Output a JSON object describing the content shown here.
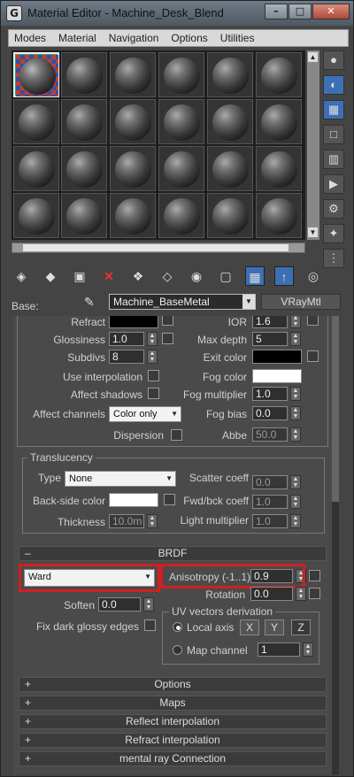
{
  "window": {
    "title": "Material Editor - Machine_Desk_Blend",
    "app_icon": "3ds-max-icon"
  },
  "menubar": [
    "Modes",
    "Material",
    "Navigation",
    "Options",
    "Utilities"
  ],
  "base": {
    "label": "Base:",
    "material_name": "Machine_BaseMetal",
    "material_type": "VRayMtl"
  },
  "refraction": {
    "refract_label": "Refract",
    "ior_label": "IOR",
    "ior_value": "1.6",
    "glossiness_label": "Glossiness",
    "glossiness_value": "1.0",
    "max_depth_label": "Max depth",
    "max_depth_value": "5",
    "subdivs_label": "Subdivs",
    "subdivs_value": "8",
    "exit_color_label": "Exit color",
    "use_interpolation_label": "Use interpolation",
    "fog_color_label": "Fog color",
    "affect_shadows_label": "Affect shadows",
    "fog_multiplier_label": "Fog multiplier",
    "fog_multiplier_value": "1.0",
    "affect_channels_label": "Affect channels",
    "affect_channels_value": "Color only",
    "fog_bias_label": "Fog bias",
    "fog_bias_value": "0.0",
    "dispersion_label": "Dispersion",
    "abbe_label": "Abbe",
    "abbe_value": "50.0"
  },
  "translucency": {
    "title": "Translucency",
    "type_label": "Type",
    "type_value": "None",
    "scatter_coeff_label": "Scatter coeff",
    "scatter_coeff_value": "0.0",
    "backside_color_label": "Back-side color",
    "fwd_bck_coeff_label": "Fwd/bck coeff",
    "fwd_bck_coeff_value": "1.0",
    "thickness_label": "Thickness",
    "thickness_value": "10.0m",
    "light_multiplier_label": "Light multiplier",
    "light_multiplier_value": "1.0"
  },
  "brdf": {
    "title": "BRDF",
    "type_value": "Ward",
    "anisotropy_label": "Anisotropy (-1..1)",
    "anisotropy_value": "0.9",
    "rotation_label": "Rotation",
    "rotation_value": "0.0",
    "soften_label": "Soften",
    "soften_value": "0.0",
    "fix_dark_label": "Fix dark glossy edges",
    "uv_group_title": "UV vectors derivation",
    "local_axis_label": "Local axis",
    "axis_x": "X",
    "axis_y": "Y",
    "axis_z": "Z",
    "map_channel_label": "Map channel",
    "map_channel_value": "1"
  },
  "rollouts": [
    "Options",
    "Maps",
    "Reflect interpolation",
    "Refract interpolation",
    "mental ray Connection"
  ],
  "colors": {
    "highlight_red": "#d21f1f",
    "selected_blue": "#3d6fb5"
  }
}
